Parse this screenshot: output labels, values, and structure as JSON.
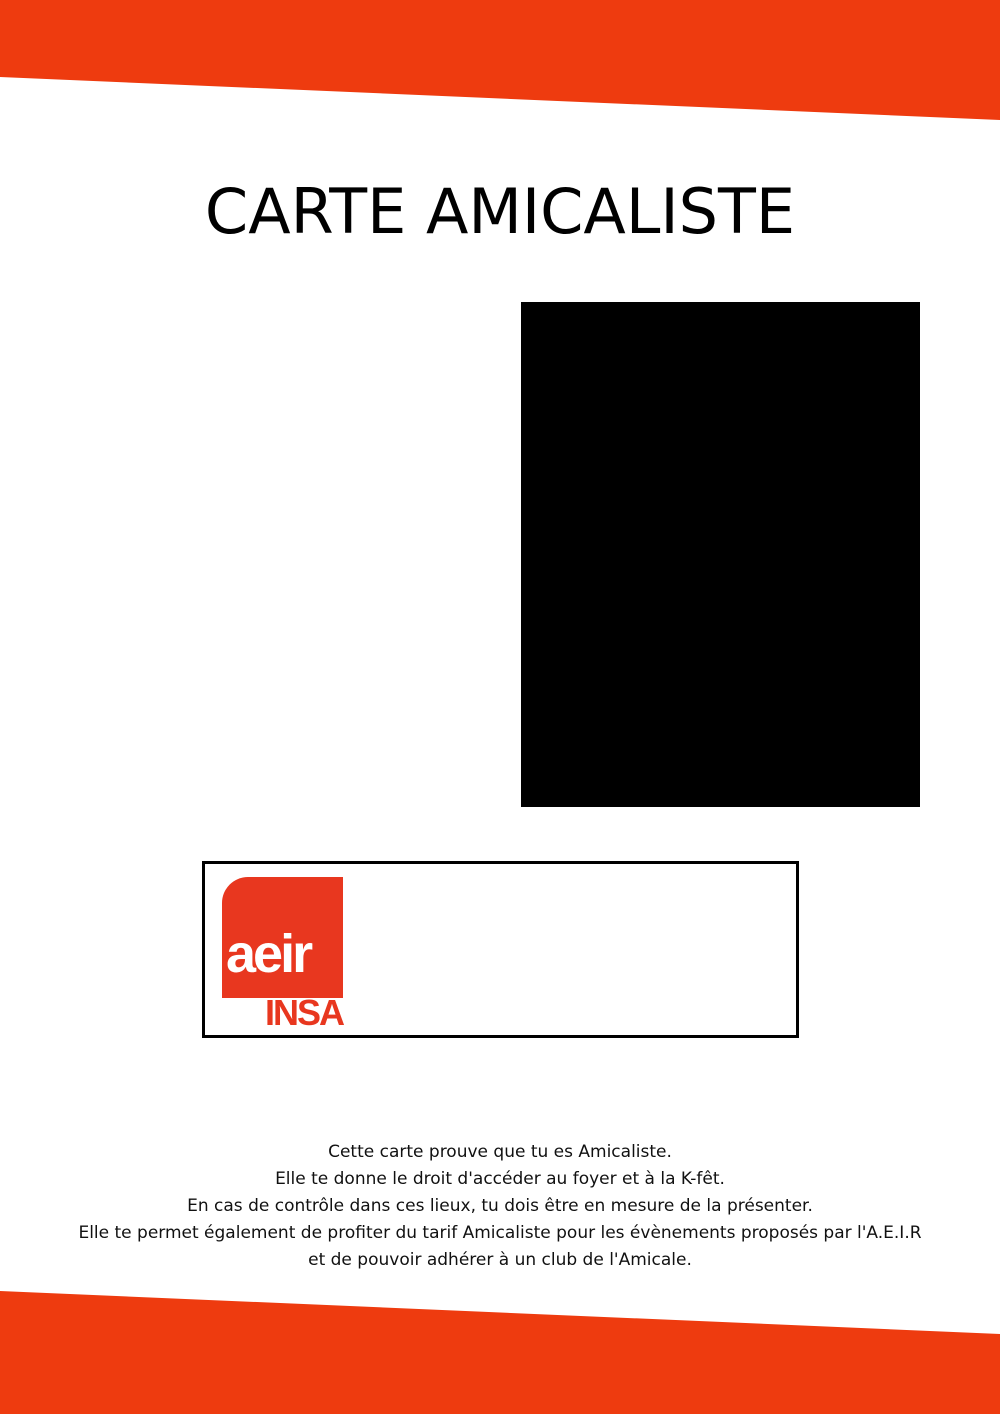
{
  "title": "CARTE AMICALISTE",
  "logo": {
    "word": "aeir",
    "sub": "INSA"
  },
  "description": [
    "Cette carte prouve que tu es Amicaliste.",
    "Elle te donne le droit d'accéder au foyer et à la K-fêt.",
    "En cas de contrôle dans ces lieux, tu dois être en mesure de la présenter.",
    "Elle te permet également de profiter du tarif Amicaliste pour les évènements proposés par l'A.E.I.R",
    "et de pouvoir adhérer à un club de l'Amicale."
  ],
  "colors": {
    "accent": "#ee3b0f",
    "logo": "#e8371f",
    "photo": "#000000"
  }
}
